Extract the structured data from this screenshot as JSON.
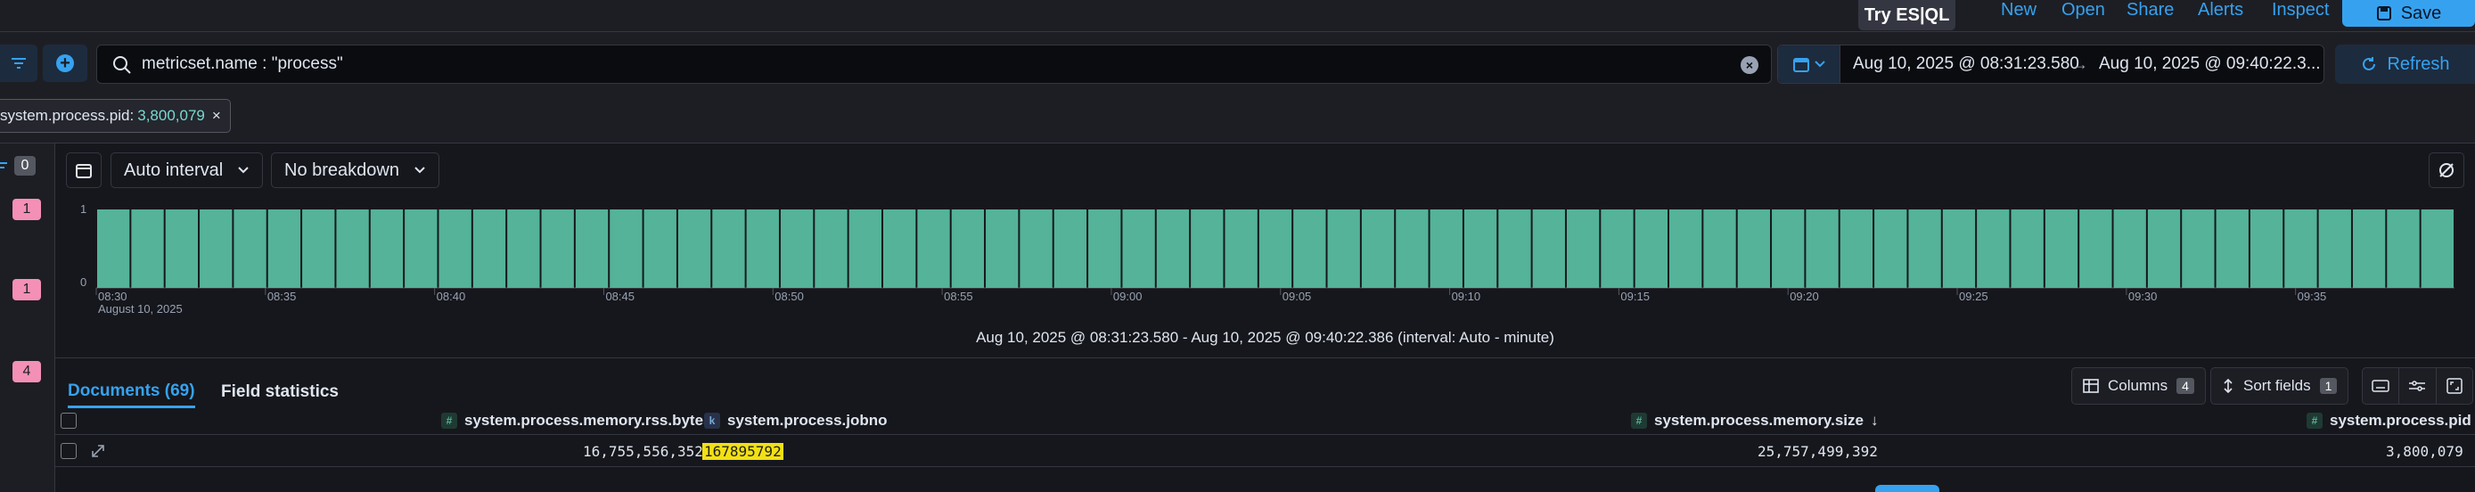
{
  "topbar": {
    "try_esql": "Try ES|QL",
    "new": "New",
    "open": "Open",
    "share": "Share",
    "alerts": "Alerts",
    "inspect": "Inspect",
    "save": "Save"
  },
  "query": {
    "text": "metricset.name : \"process\"",
    "date_start": "Aug 10, 2025 @ 08:31:23.580",
    "date_arrow": "→",
    "date_end": "Aug 10, 2025 @ 09:40:22.3...",
    "refresh": "Refresh"
  },
  "filter_pill": {
    "field": "system.process.pid:",
    "value": "3,800,079",
    "remove": "×"
  },
  "sidebar": {
    "selected_count": "0",
    "badges": [
      "1",
      "1",
      "4"
    ]
  },
  "histogram": {
    "interval": "Auto interval",
    "breakdown": "No breakdown",
    "caption": "Aug 10, 2025 @ 08:31:23.580 - Aug 10, 2025 @ 09:40:22.386 (interval: Auto - minute)"
  },
  "chart_data": {
    "type": "bar",
    "y_ticks": [
      "1",
      "0"
    ],
    "x_ticks": [
      "08:30",
      "08:35",
      "08:40",
      "08:45",
      "08:50",
      "08:55",
      "09:00",
      "09:05",
      "09:10",
      "09:15",
      "09:20",
      "09:25",
      "09:30",
      "09:35"
    ],
    "x_sublabel": "August 10, 2025",
    "bar_count": 69,
    "value_per_bar": 1,
    "ylim": [
      0,
      1
    ],
    "bar_color": "#54b399"
  },
  "docs": {
    "tab_documents": "Documents (69)",
    "tab_field_stats": "Field statistics",
    "columns_label": "Columns",
    "columns_count": "4",
    "sort_label": "Sort fields",
    "sort_count": "1",
    "headers": {
      "rss": "system.process.memory.rss.bytes",
      "jobno": "system.process.jobno",
      "size": "system.process.memory.size",
      "size_sort": "↓",
      "pid": "system.process.pid"
    },
    "type_num": "#",
    "type_kw": "k",
    "row": {
      "rss": "16,755,556,352",
      "jobno": "167895792",
      "size": "25,757,499,392",
      "pid": "3,800,079"
    }
  }
}
